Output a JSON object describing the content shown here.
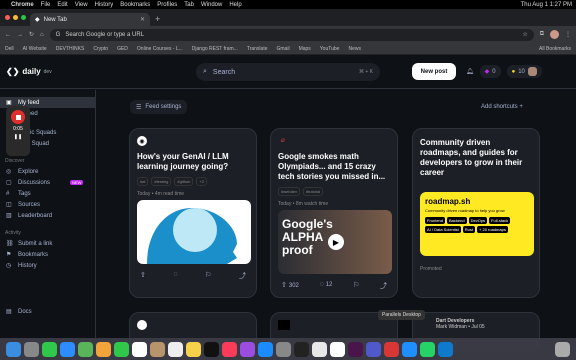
{
  "macbar": {
    "app": "Chrome",
    "menus": [
      "File",
      "Edit",
      "View",
      "History",
      "Bookmarks",
      "Profiles",
      "Tab",
      "Window",
      "Help"
    ],
    "clock": "Thu Aug 1  1:27 PM"
  },
  "tab": {
    "title": "New Tab"
  },
  "omnibox": {
    "placeholder": "Search Google or type a URL"
  },
  "bookmarks": {
    "items": [
      "Dell",
      "AI Website",
      "DEVTHINKS",
      "Crypto",
      "GED",
      "Online Courses - L...",
      "Django REST fram...",
      "Translate",
      "Gmail",
      "Maps",
      "YouTube",
      "News"
    ],
    "all": "All Bookmarks"
  },
  "header": {
    "logo": "daily",
    "logo_sub": "dev",
    "search": "Search",
    "shortcut": "⌘ + K",
    "new_post": "New post",
    "streak": "0",
    "reputation": "10"
  },
  "sidebar": {
    "items": [
      {
        "label": "My feed"
      },
      {
        "label": "..y feed"
      }
    ],
    "squads": [
      {
        "label": "Public Squads"
      },
      {
        "label": "New Squad"
      }
    ],
    "discover_head": "Discover",
    "discover": [
      {
        "label": "Explore"
      },
      {
        "label": "Discussions"
      },
      {
        "label": "Tags"
      },
      {
        "label": "Sources"
      },
      {
        "label": "Leaderboard"
      }
    ],
    "new_badge": "NEW",
    "activity_head": "Activity",
    "activity": [
      {
        "label": "Submit a link"
      },
      {
        "label": "Bookmarks"
      },
      {
        "label": "History"
      }
    ],
    "docs": "Docs",
    "rec_time": "0:05"
  },
  "feed": {
    "settings": "Feed settings",
    "add_shortcuts": "Add shortcuts"
  },
  "cards": [
    {
      "title": "How's your GenAI / LLM learning journey going?",
      "tags": [
        "#ai",
        "#testing",
        "#github",
        "+2"
      ],
      "meta": "Today • 4m read time",
      "upvotes": "",
      "comments": ""
    },
    {
      "title": "Google smokes math Olympiads... and 15 crazy tech stories you missed in...",
      "tags": [
        "#webdev",
        "#tutorial"
      ],
      "meta": "Today • 8m watch time",
      "upvotes": "302",
      "comments": "12"
    },
    {
      "title": "Community driven roadmaps, and guides for developers to grow in their career",
      "tags": [],
      "meta": "Promoted",
      "upvotes": "",
      "comments": ""
    }
  ],
  "roadmap": {
    "title": "roadmap.sh",
    "subtitle": "Community driven roadmap to help you grow",
    "chips": [
      "Frontend",
      "Backend",
      "DevOps",
      "Full-stack",
      "AI / Data Scientist",
      "Rust",
      "+ 20 roadmaps"
    ]
  },
  "video_text": "Google's ALPHA proof",
  "tooltip": "Parallels Desktop",
  "notification": {
    "title": "Dart Developers",
    "subtitle": "Mark Widman • Jul 05"
  }
}
